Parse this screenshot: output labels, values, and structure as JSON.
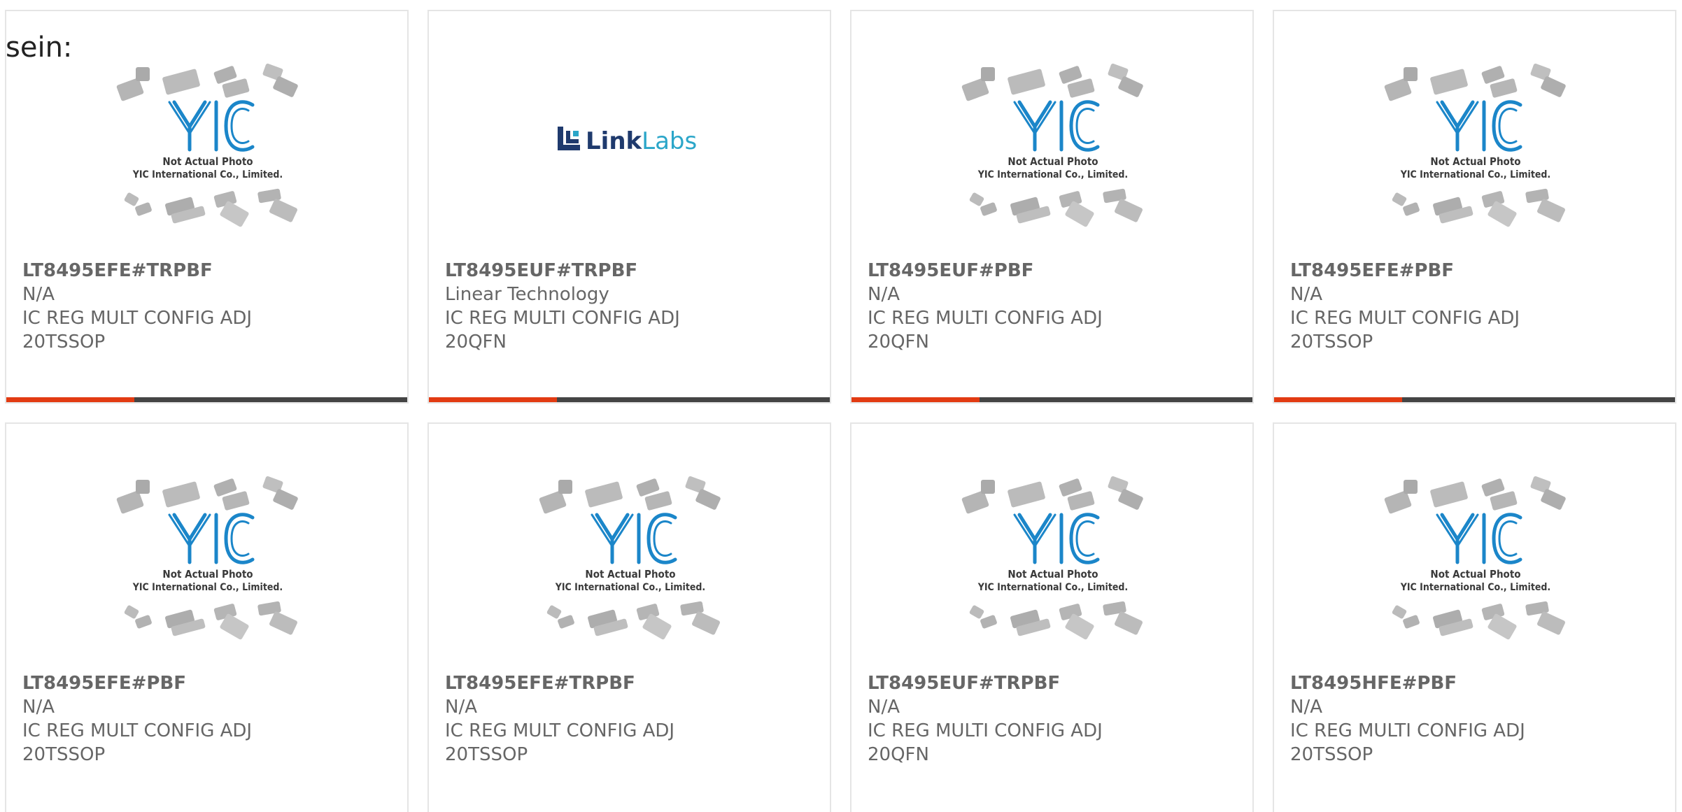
{
  "overlay_text": "sein:",
  "colors": {
    "accent": "#e23b12",
    "bar_track": "#444444",
    "border": "#e5e5e5",
    "text": "#666666",
    "yic_blue": "#1b86c9",
    "linklabs_navy": "#1f3a6d",
    "linklabs_teal": "#2ba6c9"
  },
  "placeholder_caption": {
    "line1": "Not Actual Photo",
    "line2": "YIC International Co., Limited.",
    "logo_text": "YIC"
  },
  "linklabs_logo": {
    "word_dark": "Link",
    "word_light": "Labs"
  },
  "products": [
    {
      "part_number": "LT8495EFE#TRPBF",
      "manufacturer": "N/A",
      "description": "IC REG MULT CONFIG ADJ\n20TSSOP",
      "image": "yic-placeholder-icon",
      "progress": 0.32
    },
    {
      "part_number": "LT8495EUF#TRPBF",
      "manufacturer": "Linear Technology",
      "description": "IC REG MULTI CONFIG ADJ\n20QFN",
      "image": "linklabs-logo",
      "progress": 0.32
    },
    {
      "part_number": "LT8495EUF#PBF",
      "manufacturer": "N/A",
      "description": "IC REG MULTI CONFIG ADJ\n20QFN",
      "image": "yic-placeholder-icon",
      "progress": 0.32
    },
    {
      "part_number": "LT8495EFE#PBF",
      "manufacturer": "N/A",
      "description": "IC REG MULT CONFIG ADJ\n20TSSOP",
      "image": "yic-placeholder-icon",
      "progress": 0.32
    },
    {
      "part_number": "LT8495EFE#PBF",
      "manufacturer": "N/A",
      "description": "IC REG MULT CONFIG ADJ\n20TSSOP",
      "image": "yic-placeholder-icon"
    },
    {
      "part_number": "LT8495EFE#TRPBF",
      "manufacturer": "N/A",
      "description": "IC REG MULT CONFIG ADJ\n20TSSOP",
      "image": "yic-placeholder-icon"
    },
    {
      "part_number": "LT8495EUF#TRPBF",
      "manufacturer": "N/A",
      "description": "IC REG MULTI CONFIG ADJ\n20QFN",
      "image": "yic-placeholder-icon"
    },
    {
      "part_number": "LT8495HFE#PBF",
      "manufacturer": "N/A",
      "description": "IC REG MULTI CONFIG ADJ\n20TSSOP",
      "image": "yic-placeholder-icon"
    }
  ]
}
